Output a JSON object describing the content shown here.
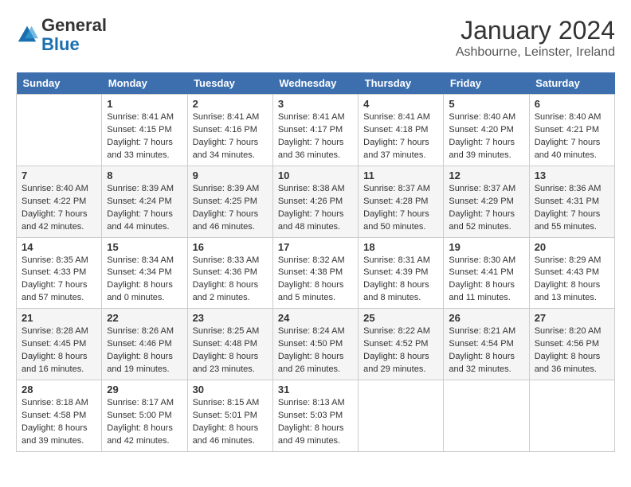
{
  "header": {
    "logo_general": "General",
    "logo_blue": "Blue",
    "month_title": "January 2024",
    "location": "Ashbourne, Leinster, Ireland"
  },
  "calendar": {
    "days_of_week": [
      "Sunday",
      "Monday",
      "Tuesday",
      "Wednesday",
      "Thursday",
      "Friday",
      "Saturday"
    ],
    "weeks": [
      [
        {
          "day": "",
          "sunrise": "",
          "sunset": "",
          "daylight": ""
        },
        {
          "day": "1",
          "sunrise": "Sunrise: 8:41 AM",
          "sunset": "Sunset: 4:15 PM",
          "daylight": "Daylight: 7 hours and 33 minutes."
        },
        {
          "day": "2",
          "sunrise": "Sunrise: 8:41 AM",
          "sunset": "Sunset: 4:16 PM",
          "daylight": "Daylight: 7 hours and 34 minutes."
        },
        {
          "day": "3",
          "sunrise": "Sunrise: 8:41 AM",
          "sunset": "Sunset: 4:17 PM",
          "daylight": "Daylight: 7 hours and 36 minutes."
        },
        {
          "day": "4",
          "sunrise": "Sunrise: 8:41 AM",
          "sunset": "Sunset: 4:18 PM",
          "daylight": "Daylight: 7 hours and 37 minutes."
        },
        {
          "day": "5",
          "sunrise": "Sunrise: 8:40 AM",
          "sunset": "Sunset: 4:20 PM",
          "daylight": "Daylight: 7 hours and 39 minutes."
        },
        {
          "day": "6",
          "sunrise": "Sunrise: 8:40 AM",
          "sunset": "Sunset: 4:21 PM",
          "daylight": "Daylight: 7 hours and 40 minutes."
        }
      ],
      [
        {
          "day": "7",
          "sunrise": "Sunrise: 8:40 AM",
          "sunset": "Sunset: 4:22 PM",
          "daylight": "Daylight: 7 hours and 42 minutes."
        },
        {
          "day": "8",
          "sunrise": "Sunrise: 8:39 AM",
          "sunset": "Sunset: 4:24 PM",
          "daylight": "Daylight: 7 hours and 44 minutes."
        },
        {
          "day": "9",
          "sunrise": "Sunrise: 8:39 AM",
          "sunset": "Sunset: 4:25 PM",
          "daylight": "Daylight: 7 hours and 46 minutes."
        },
        {
          "day": "10",
          "sunrise": "Sunrise: 8:38 AM",
          "sunset": "Sunset: 4:26 PM",
          "daylight": "Daylight: 7 hours and 48 minutes."
        },
        {
          "day": "11",
          "sunrise": "Sunrise: 8:37 AM",
          "sunset": "Sunset: 4:28 PM",
          "daylight": "Daylight: 7 hours and 50 minutes."
        },
        {
          "day": "12",
          "sunrise": "Sunrise: 8:37 AM",
          "sunset": "Sunset: 4:29 PM",
          "daylight": "Daylight: 7 hours and 52 minutes."
        },
        {
          "day": "13",
          "sunrise": "Sunrise: 8:36 AM",
          "sunset": "Sunset: 4:31 PM",
          "daylight": "Daylight: 7 hours and 55 minutes."
        }
      ],
      [
        {
          "day": "14",
          "sunrise": "Sunrise: 8:35 AM",
          "sunset": "Sunset: 4:33 PM",
          "daylight": "Daylight: 7 hours and 57 minutes."
        },
        {
          "day": "15",
          "sunrise": "Sunrise: 8:34 AM",
          "sunset": "Sunset: 4:34 PM",
          "daylight": "Daylight: 8 hours and 0 minutes."
        },
        {
          "day": "16",
          "sunrise": "Sunrise: 8:33 AM",
          "sunset": "Sunset: 4:36 PM",
          "daylight": "Daylight: 8 hours and 2 minutes."
        },
        {
          "day": "17",
          "sunrise": "Sunrise: 8:32 AM",
          "sunset": "Sunset: 4:38 PM",
          "daylight": "Daylight: 8 hours and 5 minutes."
        },
        {
          "day": "18",
          "sunrise": "Sunrise: 8:31 AM",
          "sunset": "Sunset: 4:39 PM",
          "daylight": "Daylight: 8 hours and 8 minutes."
        },
        {
          "day": "19",
          "sunrise": "Sunrise: 8:30 AM",
          "sunset": "Sunset: 4:41 PM",
          "daylight": "Daylight: 8 hours and 11 minutes."
        },
        {
          "day": "20",
          "sunrise": "Sunrise: 8:29 AM",
          "sunset": "Sunset: 4:43 PM",
          "daylight": "Daylight: 8 hours and 13 minutes."
        }
      ],
      [
        {
          "day": "21",
          "sunrise": "Sunrise: 8:28 AM",
          "sunset": "Sunset: 4:45 PM",
          "daylight": "Daylight: 8 hours and 16 minutes."
        },
        {
          "day": "22",
          "sunrise": "Sunrise: 8:26 AM",
          "sunset": "Sunset: 4:46 PM",
          "daylight": "Daylight: 8 hours and 19 minutes."
        },
        {
          "day": "23",
          "sunrise": "Sunrise: 8:25 AM",
          "sunset": "Sunset: 4:48 PM",
          "daylight": "Daylight: 8 hours and 23 minutes."
        },
        {
          "day": "24",
          "sunrise": "Sunrise: 8:24 AM",
          "sunset": "Sunset: 4:50 PM",
          "daylight": "Daylight: 8 hours and 26 minutes."
        },
        {
          "day": "25",
          "sunrise": "Sunrise: 8:22 AM",
          "sunset": "Sunset: 4:52 PM",
          "daylight": "Daylight: 8 hours and 29 minutes."
        },
        {
          "day": "26",
          "sunrise": "Sunrise: 8:21 AM",
          "sunset": "Sunset: 4:54 PM",
          "daylight": "Daylight: 8 hours and 32 minutes."
        },
        {
          "day": "27",
          "sunrise": "Sunrise: 8:20 AM",
          "sunset": "Sunset: 4:56 PM",
          "daylight": "Daylight: 8 hours and 36 minutes."
        }
      ],
      [
        {
          "day": "28",
          "sunrise": "Sunrise: 8:18 AM",
          "sunset": "Sunset: 4:58 PM",
          "daylight": "Daylight: 8 hours and 39 minutes."
        },
        {
          "day": "29",
          "sunrise": "Sunrise: 8:17 AM",
          "sunset": "Sunset: 5:00 PM",
          "daylight": "Daylight: 8 hours and 42 minutes."
        },
        {
          "day": "30",
          "sunrise": "Sunrise: 8:15 AM",
          "sunset": "Sunset: 5:01 PM",
          "daylight": "Daylight: 8 hours and 46 minutes."
        },
        {
          "day": "31",
          "sunrise": "Sunrise: 8:13 AM",
          "sunset": "Sunset: 5:03 PM",
          "daylight": "Daylight: 8 hours and 49 minutes."
        },
        {
          "day": "",
          "sunrise": "",
          "sunset": "",
          "daylight": ""
        },
        {
          "day": "",
          "sunrise": "",
          "sunset": "",
          "daylight": ""
        },
        {
          "day": "",
          "sunrise": "",
          "sunset": "",
          "daylight": ""
        }
      ]
    ]
  }
}
